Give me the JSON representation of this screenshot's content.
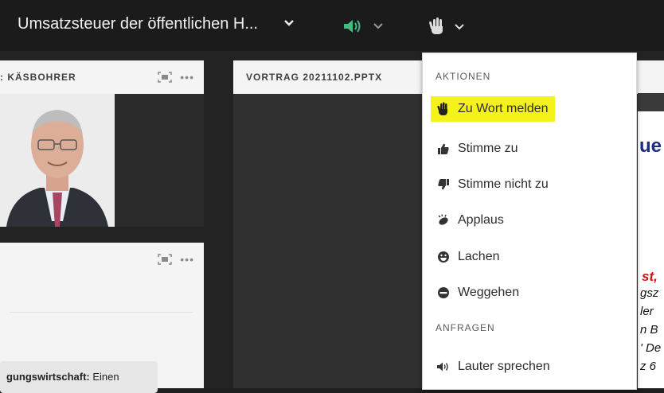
{
  "header": {
    "meeting_title": "Umsatzsteuer der öffentlichen H...",
    "icons": {
      "title_dropdown": "chevron-down-icon",
      "speaker": "speaker-icon",
      "hand": "raise-hand-icon"
    },
    "speaker_color": "#3fbf7f"
  },
  "video_pod": {
    "title": ": KÄSBOHRER",
    "menu": "•••"
  },
  "chat_pod": {
    "title": "",
    "menu": "•••",
    "message_bold": "gungswirtschaft:",
    "message_rest": " Einen"
  },
  "share_pod": {
    "title": "VORTRAG 20211102.PPTX",
    "menu": "",
    "slide_heading": "ue",
    "slide_red": "st,",
    "slide_lines": [
      "gsz",
      "ler",
      "n B",
      "' De",
      "z 6"
    ]
  },
  "status_menu": {
    "section_actions": "AKTIONEN",
    "section_requests": "ANFRAGEN",
    "items": [
      {
        "label": "Zu Wort melden",
        "icon": "raise-hand-icon",
        "highlighted": true
      },
      {
        "label": "Stimme zu",
        "icon": "thumbs-up-icon"
      },
      {
        "label": "Stimme nicht zu",
        "icon": "thumbs-down-icon"
      },
      {
        "label": "Applaus",
        "icon": "applause-icon"
      },
      {
        "label": "Lachen",
        "icon": "laugh-icon"
      },
      {
        "label": "Weggehen",
        "icon": "step-away-icon"
      },
      {
        "label": "Lauter sprechen",
        "icon": "speak-louder-icon"
      }
    ],
    "highlight_color": "#f5f21a"
  }
}
